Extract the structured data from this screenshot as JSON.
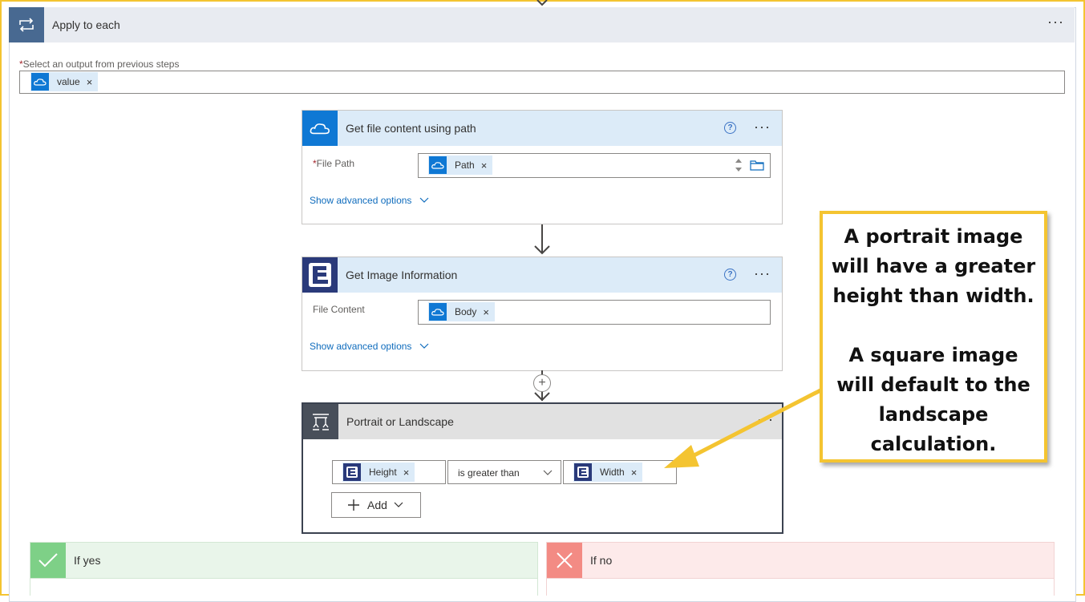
{
  "apply_to_each": {
    "title": "Apply to each",
    "more_label": "···",
    "output_label": "Select an output from previous steps",
    "output_required_mark": "*",
    "output_token": {
      "label": "value",
      "icon": "onedrive-icon",
      "remove": "×"
    }
  },
  "get_file": {
    "title": "Get file content using path",
    "help": "?",
    "more_label": "···",
    "field_label": "File Path",
    "field_required_mark": "*",
    "token": {
      "label": "Path",
      "icon": "onedrive-icon",
      "remove": "×"
    },
    "advanced": "Show advanced options"
  },
  "get_image": {
    "title": "Get Image Information",
    "help": "?",
    "more_label": "···",
    "field_label": "File Content",
    "token": {
      "label": "Body",
      "icon": "onedrive-icon",
      "remove": "×"
    },
    "advanced": "Show advanced options"
  },
  "condition": {
    "title": "Portrait or Landscape",
    "more_label": "···",
    "left_token": {
      "label": "Height",
      "icon": "encodian-icon",
      "remove": "×"
    },
    "operator": "is greater than",
    "right_token": {
      "label": "Width",
      "icon": "encodian-icon",
      "remove": "×"
    },
    "add_label": "Add"
  },
  "branches": {
    "yes_label": "If yes",
    "no_label": "If no"
  },
  "callout": {
    "paragraph1": "A portrait image will have a greater height than width.",
    "paragraph2": "A square image will default to the landscape calculation."
  },
  "colors": {
    "highlight_border": "#f4c431",
    "apply_header": "#486991",
    "onedrive_blue": "#0f78d4",
    "condition_icon": "#484f5a",
    "yes_green": "#7ed087",
    "no_red": "#f38b84",
    "link_blue": "#0f6cbd"
  }
}
